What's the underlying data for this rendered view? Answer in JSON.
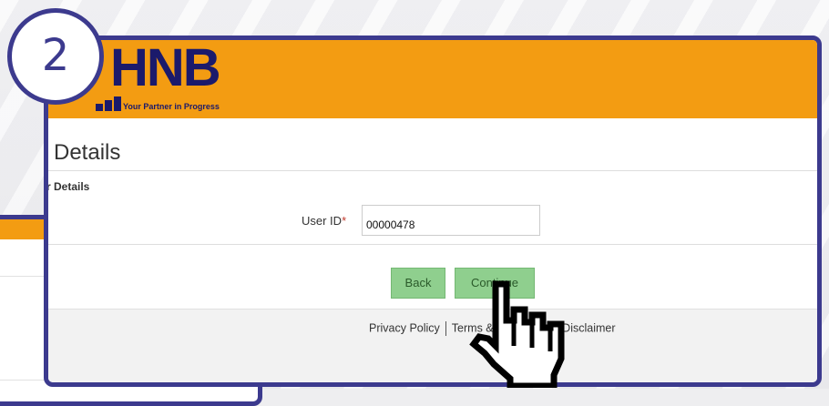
{
  "step_number": "2",
  "brand": {
    "name": "HNB",
    "tagline": "Your Partner in Progress"
  },
  "page": {
    "title": "Details",
    "section_title": "r Details"
  },
  "form": {
    "user_id_label": "User ID",
    "required_mark": "*",
    "user_id_value": "00000478"
  },
  "buttons": {
    "back": "Back",
    "continue": "Continue"
  },
  "footer": {
    "privacy": "Privacy Policy",
    "terms": "Terms & Conditions",
    "disclaimer": "Disclaimer"
  },
  "colors": {
    "header": "#f39c12",
    "frame": "#3c3a8e",
    "button": "#8fcf8e"
  },
  "icons": [
    "hand-pointer-icon"
  ]
}
